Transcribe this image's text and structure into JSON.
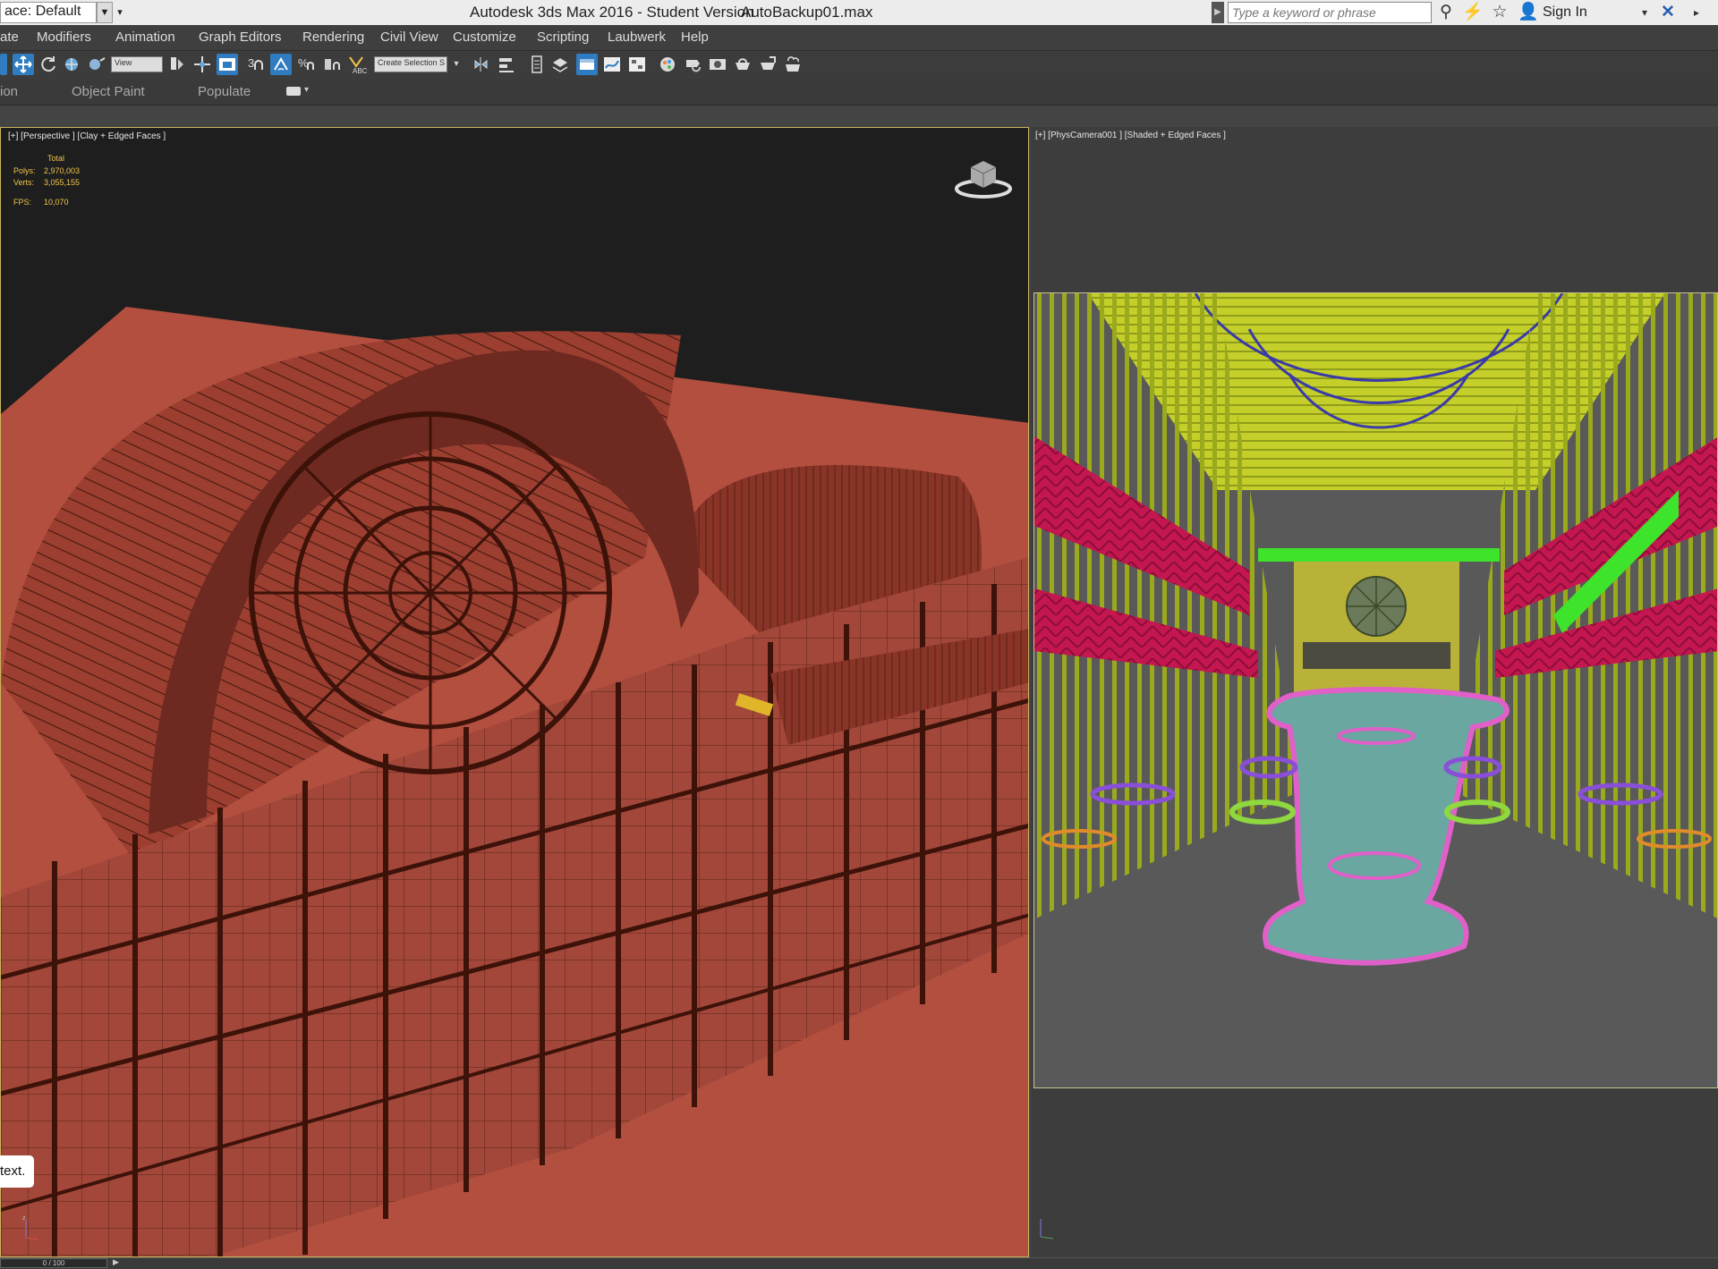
{
  "title_bar": {
    "workspace": "ace: Default",
    "app_title": "Autodesk 3ds Max 2016 - Student Version",
    "file_name": "AutoBackup01.max",
    "search_placeholder": "Type a keyword or phrase",
    "sign_in": "Sign In"
  },
  "menu": [
    "ate",
    "Modifiers",
    "Animation",
    "Graph Editors",
    "Rendering",
    "Civil View",
    "Customize",
    "Scripting",
    "Laubwerk",
    "Help"
  ],
  "toolbar": {
    "view_select": "View",
    "selection_set": "Create Selection S"
  },
  "ribbon": [
    "ion",
    "Object Paint",
    "Populate"
  ],
  "viewport_left": {
    "label": "[+] [Perspective ] [Clay + Edged Faces ]",
    "stats": {
      "header": "Total",
      "polys_label": "Polys:",
      "polys": "2,970,003",
      "verts_label": "Verts:",
      "verts": "3,055,155",
      "fps_label": "FPS:",
      "fps": "10,070"
    }
  },
  "viewport_right": {
    "label": "[+] [PhysCamera001 ] [Shaded + Edged Faces ]"
  },
  "tooltip": "text.",
  "time_slider": "0 / 100",
  "colors": {
    "clay": "#b24f3f",
    "clay_dark": "#5a2418",
    "accent_blue": "#2f7cc0",
    "stats_yellow": "#f0c34a",
    "viewport_border": "#c9b760"
  }
}
